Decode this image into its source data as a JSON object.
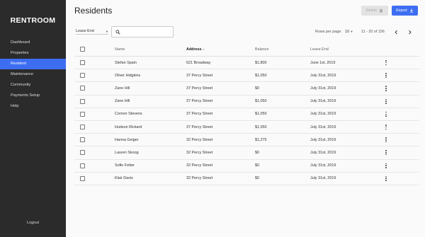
{
  "sidebar": {
    "logo": "RENTROOM",
    "items": [
      {
        "label": "Dashboard"
      },
      {
        "label": "Properties"
      },
      {
        "label": "Resident"
      },
      {
        "label": "Maintenance"
      },
      {
        "label": "Community"
      },
      {
        "label": "Payments Setup"
      },
      {
        "label": "Help"
      }
    ],
    "active_index": 2,
    "logout": "Logout"
  },
  "header": {
    "title": "Residents",
    "delete_label": "Delete",
    "export_label": "Export",
    "delete_icon": "trash-icon",
    "export_icon": "download-icon"
  },
  "toolbar": {
    "filter_value": "Lease End",
    "search_value": "",
    "search_placeholder": "",
    "rows_per_page_label": "Rows per page:",
    "rows_per_page_value": "10",
    "range_text": "11 - 20 of 156"
  },
  "table": {
    "columns": {
      "name": "Name",
      "address": "Address",
      "balance": "Balance",
      "lease_end": "Lease End"
    },
    "sort_column": "address",
    "sort_direction": "descending",
    "rows": [
      {
        "name": "Stefan Spain",
        "address": "621 Broadway",
        "balance": "$1,800",
        "lease_end": "June 1st, 2019"
      },
      {
        "name": "Oliver Hidgkins",
        "address": "37 Percy Street",
        "balance": "$1,050",
        "lease_end": "July 31st, 2019"
      },
      {
        "name": "Zane Hill",
        "address": "37 Percy Street",
        "balance": "$0",
        "lease_end": "July 31st, 2019"
      },
      {
        "name": "Zane Hill",
        "address": "37 Percy Street",
        "balance": "$1,050",
        "lease_end": "July 31st, 2019"
      },
      {
        "name": "Connor Stevens",
        "address": "37 Percy Street",
        "balance": "$1,050",
        "lease_end": "July 31st, 2019"
      },
      {
        "name": "Hudson Rickard",
        "address": "37 Percy Street",
        "balance": "$1,050",
        "lease_end": "July 31st, 2019"
      },
      {
        "name": "Hanna Geiger",
        "address": "32 Percy Street",
        "balance": "$1,275",
        "lease_end": "July 31st, 2019"
      },
      {
        "name": "Lauren Skoog",
        "address": "32 Percy Street",
        "balance": "$0",
        "lease_end": "July 31st, 2019"
      },
      {
        "name": "Sofie Fetter",
        "address": "32 Percy Street",
        "balance": "$0",
        "lease_end": "July 31st, 2019"
      },
      {
        "name": "Klair Davis",
        "address": "32 Percy Street",
        "balance": "$0",
        "lease_end": "July 31st, 2019"
      }
    ]
  },
  "colors": {
    "accent": "#3d6ef2",
    "sidebar_bg": "#2b2b2b"
  }
}
